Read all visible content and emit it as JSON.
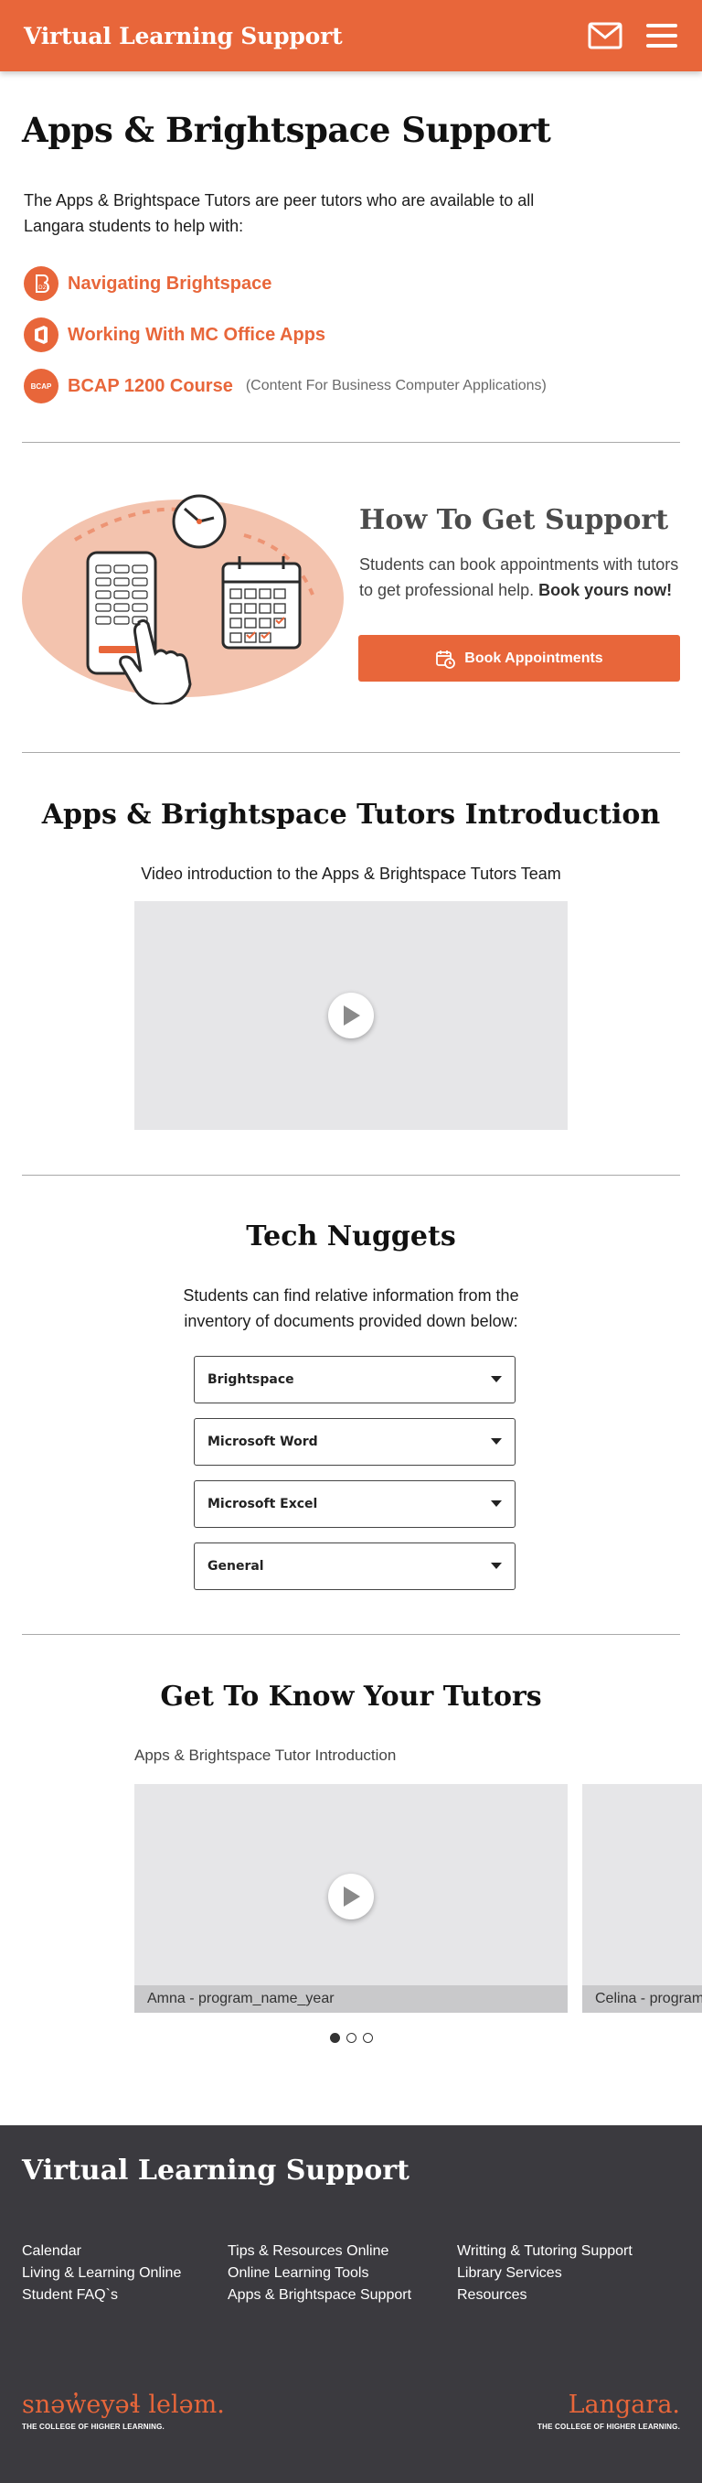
{
  "header": {
    "brand": "Virtual Learning Support",
    "icons": [
      "mail-icon",
      "menu-icon"
    ],
    "accent_color": "#e8663a"
  },
  "intro": {
    "title": "Apps & Brightspace Support",
    "description": "The Apps & Brightspace Tutors are peer tutors who are available to all Langara students to help with:",
    "features": [
      {
        "label": "Navigating Brightspace",
        "icon": "brightspace-icon",
        "note": ""
      },
      {
        "label": "Working With MC Office Apps",
        "icon": "office-icon",
        "note": ""
      },
      {
        "label": "BCAP 1200 Course",
        "icon": "bcap-icon",
        "icon_text": "BCAP",
        "note": "(Content For Business Computer Applications)"
      }
    ]
  },
  "support": {
    "title": "How To Get Support",
    "text": "Students can book appointments with tutors to get professional help.",
    "text_bold": "Book yours now!",
    "button_label": "Book Appointments"
  },
  "introduction": {
    "title": "Apps & Brightspace Tutors Introduction",
    "subtitle": "Video introduction to the Apps & Brightspace Tutors Team"
  },
  "nuggets": {
    "title": "Tech Nuggets",
    "subtitle": "Students can find relative information from the inventory of documents provided down below:",
    "dropdowns": [
      "Brightspace",
      "Microsoft Word",
      "Microsoft Excel",
      "General"
    ]
  },
  "tutors": {
    "title": "Get To Know Your Tutors",
    "caption": "Apps & Brightspace Tutor Introduction",
    "slides": [
      {
        "name": "Amna - program_name_year"
      },
      {
        "name": "Celina - program_name_year"
      }
    ],
    "dots": 3,
    "active_dot": 1
  },
  "footer": {
    "title": "Virtual Learning Support",
    "col1": [
      "Calendar",
      "Living & Learning Online",
      "Student FAQ`s"
    ],
    "col2": [
      "Tips & Resources Online",
      "Online Learning Tools",
      "Apps & Brightspace Support"
    ],
    "col3": [
      "Writting & Tutoring Support",
      "Library Services",
      "Resources"
    ],
    "logo_left": "snəw̓eyəɬ leləm.",
    "logo_left_tag": "THE COLLEGE OF HIGHER LEARNING.",
    "logo_right": "Langara.",
    "logo_right_tag": "THE COLLEGE OF HIGHER LEARNING."
  }
}
